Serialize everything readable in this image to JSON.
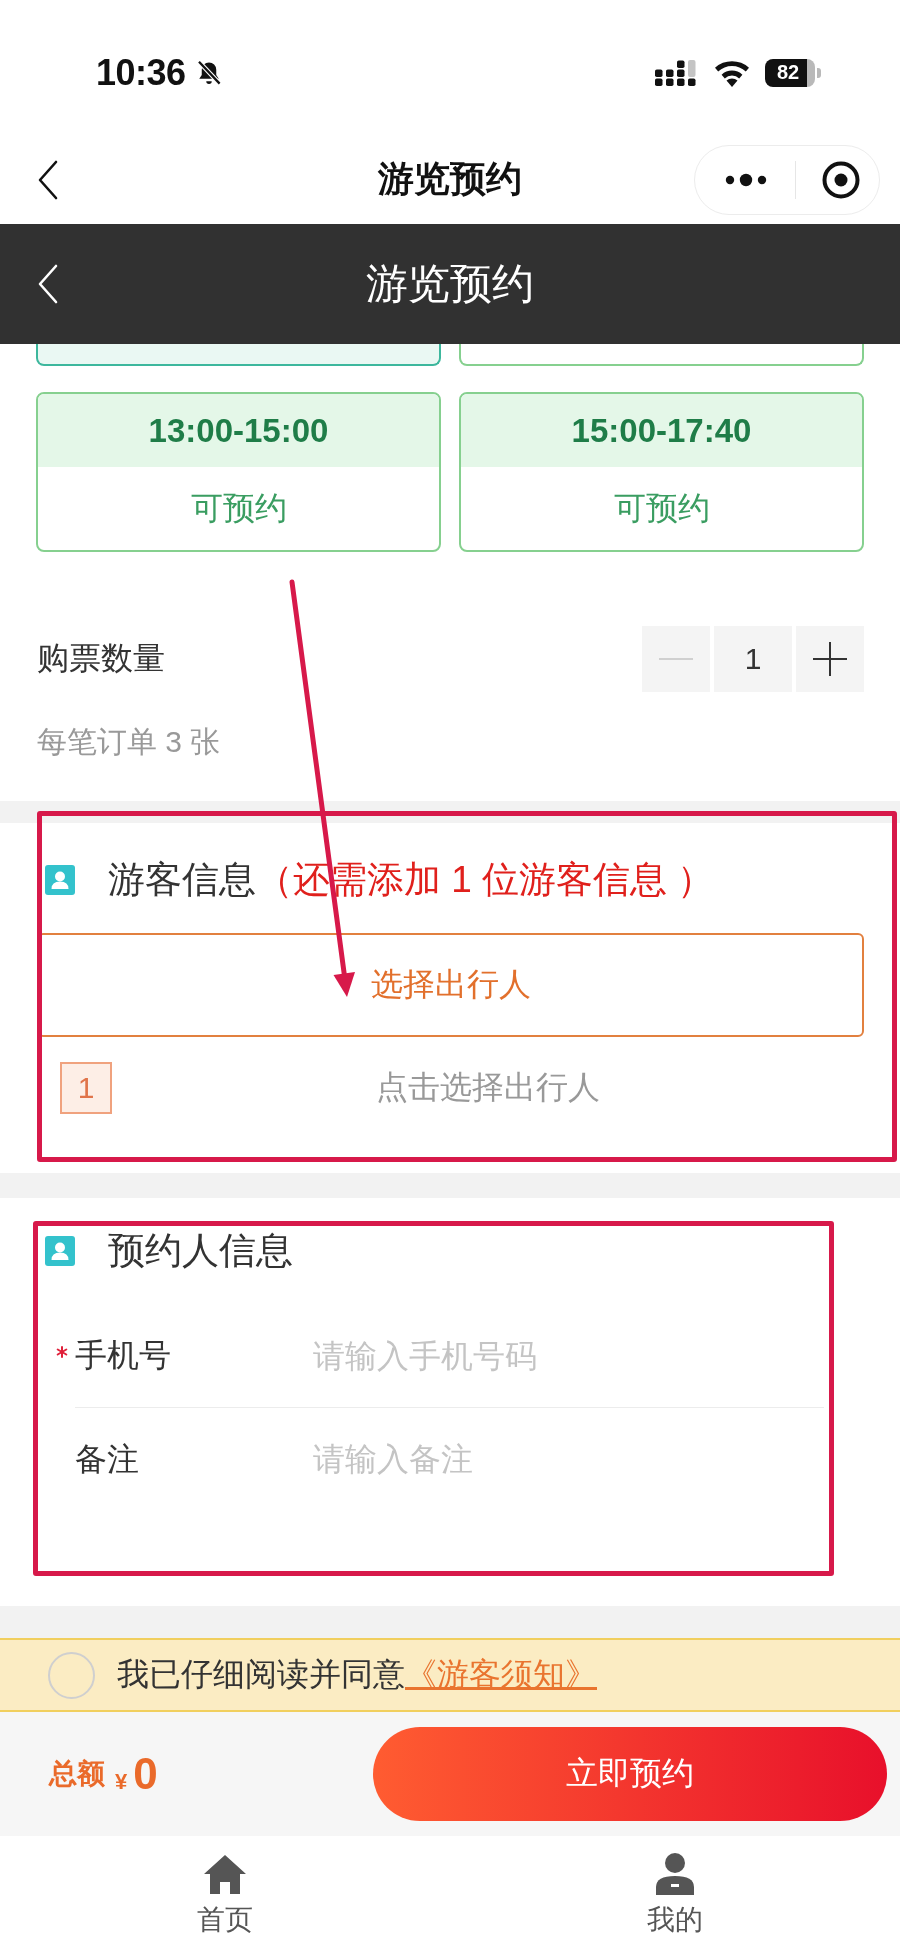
{
  "status_bar": {
    "time": "10:36",
    "battery": "82"
  },
  "nav_bar": {
    "title": "游览预约"
  },
  "header": {
    "title": "游览预约"
  },
  "time_slots": [
    {
      "kind": "partial",
      "selected": true
    },
    {
      "kind": "partial",
      "selected": false
    },
    {
      "kind": "full",
      "time": "13:00-15:00",
      "status": "可预约",
      "selected": false
    },
    {
      "kind": "full",
      "time": "15:00-17:40",
      "status": "可预约",
      "selected": false
    }
  ],
  "quantity": {
    "label": "购票数量",
    "value": "1",
    "note": "每笔订单 3 张",
    "decrease": {
      "disabled": true
    },
    "increase": {
      "disabled": false
    }
  },
  "visitor_section": {
    "title": "游客信息",
    "hint": "（还需添加 1 位游客信息 ）",
    "highlighted": true,
    "select_button": "选择出行人",
    "travelers": [
      {
        "index": "1",
        "prompt": "点击选择出行人"
      }
    ]
  },
  "booker_section": {
    "title": "预约人信息",
    "highlighted": true,
    "fields": [
      {
        "label": "手机号",
        "required": true,
        "placeholder": "请输入手机号码"
      },
      {
        "label": "备注",
        "required": false,
        "placeholder": "请输入备注"
      }
    ]
  },
  "agreement": {
    "checked": false,
    "text": "我已仔细阅读并同意",
    "link": "《游客须知》"
  },
  "footer": {
    "total_label": "总额",
    "currency": "¥",
    "total": "0",
    "submit": "立即预约"
  },
  "tab_bar": [
    {
      "kind": "home",
      "label": "首页"
    },
    {
      "kind": "profile",
      "label": "我的"
    }
  ],
  "arrow_annotation": true
}
